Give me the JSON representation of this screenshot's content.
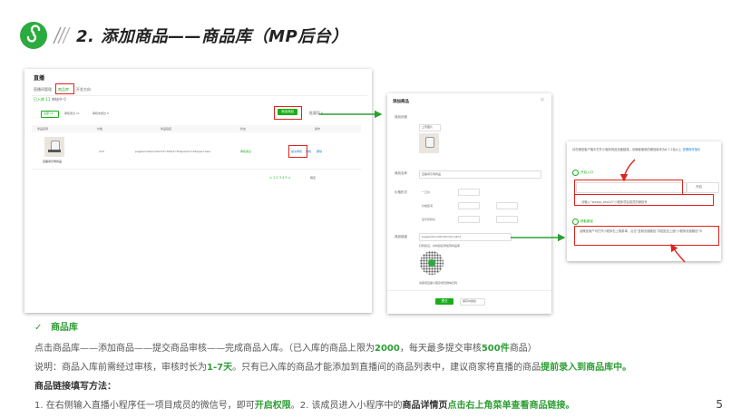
{
  "title": "2. 添加商品——商品库（MP后台）",
  "panel1": {
    "heading": "直播",
    "tabs": [
      "直播间管理",
      "商品库",
      "开发方向"
    ],
    "sub_tabs": [
      "已入库 11",
      "审核中 0"
    ],
    "filters": [
      "全部 11",
      "审核通过 11",
      "审核未通过 0"
    ],
    "add_button": "添加商品",
    "import_link": "批量导入",
    "columns": [
      "商品名称",
      "价格",
      "商品链接",
      "状态",
      "操作"
    ],
    "row": {
      "name": "直播间示例商品",
      "price": "123",
      "path": "pages/index/index?id=10&id=t1&param=4&type=sale",
      "status": "审核通过",
      "action1": "提交审核",
      "action2": "编辑",
      "action3": "删除"
    },
    "pager": "< 1 2 3 4 5 >",
    "goto": "跳至"
  },
  "panel2": {
    "heading": "添加商品",
    "labels": [
      "商品封面",
      "商品名称",
      "价格形式",
      "商品链接"
    ],
    "upload": "上传图片",
    "name_value": "直播间示例商品",
    "price_options": [
      "一口价",
      "价格区间",
      "显示折扣价"
    ],
    "price_suffix": "元",
    "path_value": "pages/item/list?itemId=abcd",
    "qr_caption": "扫码验证，并将链接添加到商品库",
    "qr_note": "请使用直播小程序成员微信扫码",
    "confirm": "提交",
    "cancel": "保存并继续"
  },
  "panel3": {
    "top_note": "请在微信客户端中打开小程序商品页面链接，请确保使用的微信版本为6.7.2及以上",
    "top_link": "查看操作指引",
    "step1": "开启入口",
    "open_btn": "开启",
    "hint1": "请输入“wxapp_test10”小程序项目成员的微信号",
    "step2": "获取路径",
    "hint2": "该微信用户可打开小程序右上角菜单，点击“复制页面路径”并粘贴至上面“小程序页面路径”中"
  },
  "body": {
    "bullet": "✓",
    "section_title": "商品库",
    "line1_a": "点击商品库——添加商品——提交商品审核——完成商品入库。（已入库的商品上限为",
    "line1_b": "2000",
    "line1_c": "，每天最多提交审核",
    "line1_d": "500件",
    "line1_e": "商品）",
    "line2_a": "说明：商品入库前需经过审核，审核时长为",
    "line2_b": "1-7天",
    "line2_c": "。只有已入库的商品才能添加到直播间的商品列表中，建议商家将直播的商品",
    "line2_d": "提前录入到商品库中。",
    "line3": "商品链接填写方法：",
    "line4_a": "1. 在右侧输入直播小程序任一项目成员的微信号，即可",
    "line4_b": "开启权限",
    "line4_c": "。2. 该成员进入小程序中的",
    "line4_d": "商品详情页",
    "line4_e": "点击右上角菜单查看商品链接。",
    "page": "5"
  },
  "colors": {
    "green": "#2e9e35",
    "red": "#e0231b",
    "logo": "#2bab3f"
  }
}
